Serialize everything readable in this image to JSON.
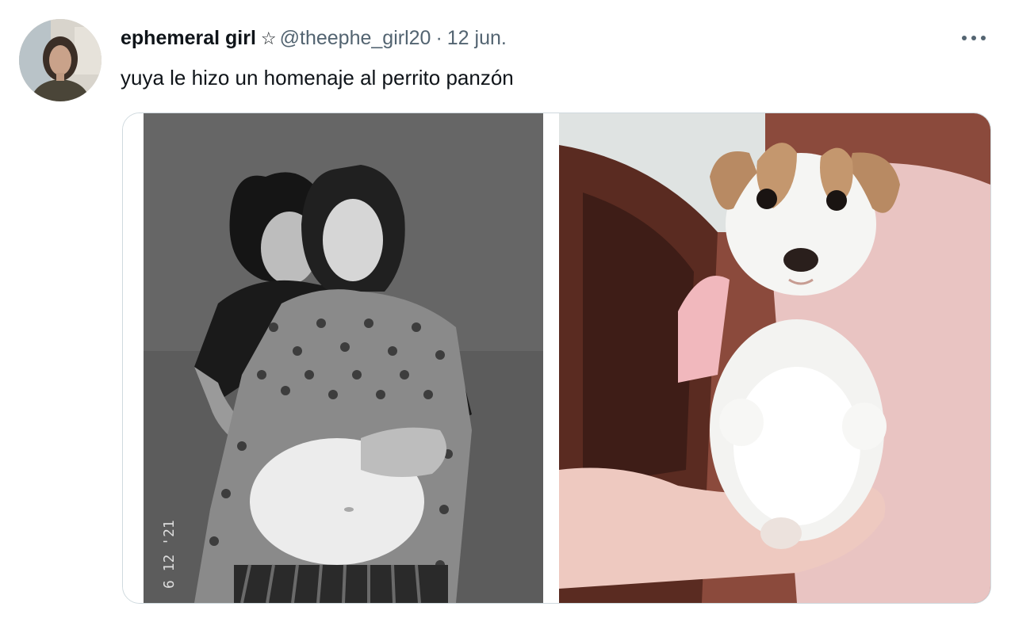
{
  "tweet": {
    "display_name": "ephemeral girl",
    "badge_icon": "star-outline-icon",
    "handle": "@theephe_girl20",
    "separator": "·",
    "date": "12 jun.",
    "text": "yuya le hizo un homenaje al perrito panzón",
    "more_icon": "more-horizontal-icon"
  },
  "media": {
    "photo_count": 2,
    "left_photo_caption": "6 12 '21"
  }
}
